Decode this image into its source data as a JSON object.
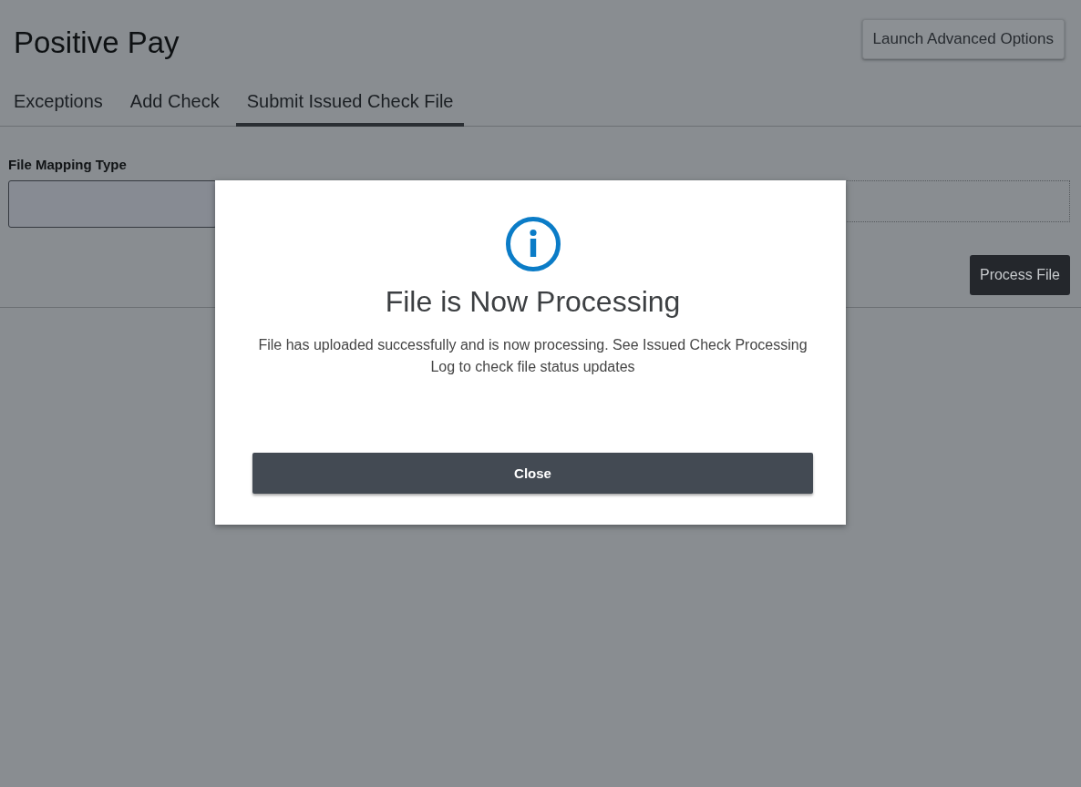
{
  "page": {
    "title": "Positive Pay",
    "action_button": "Launch Advanced Options"
  },
  "tabs": [
    {
      "label": "Exceptions",
      "selected": false
    },
    {
      "label": "Add Check",
      "selected": false
    },
    {
      "label": "Submit Issued Check File",
      "selected": true
    }
  ],
  "form": {
    "field_label": "File Mapping Type",
    "process_button": "Process File"
  },
  "dialog": {
    "title": "File is Now Processing",
    "message": "File has uploaded successfully and is now processing. See Issued Check Processing Log to check file status updates",
    "close_button": "Close"
  }
}
